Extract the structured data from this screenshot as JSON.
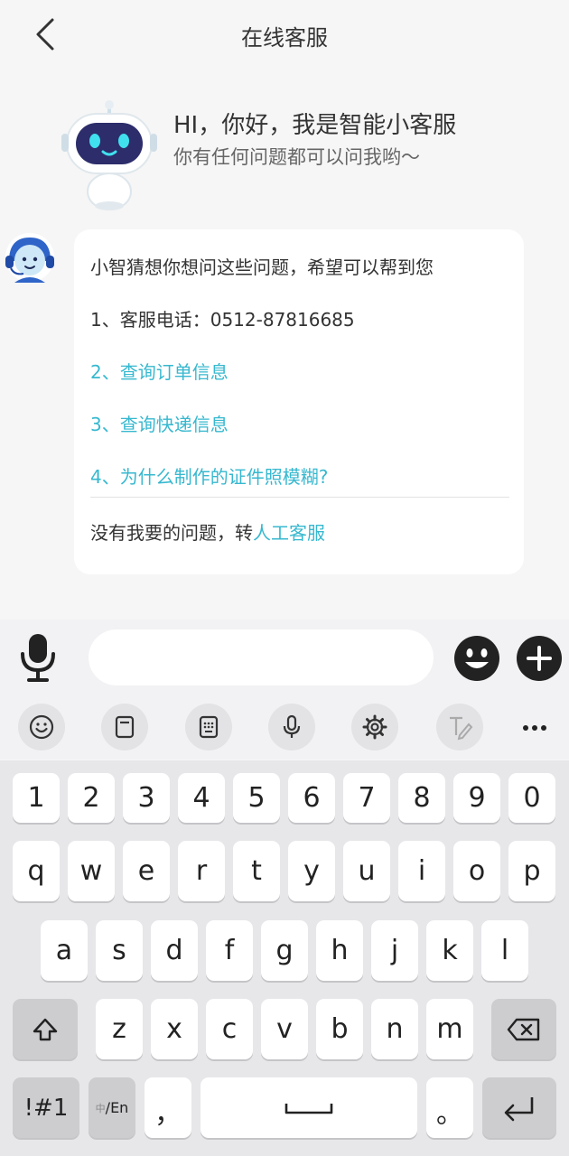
{
  "header": {
    "title": "在线客服"
  },
  "greeting": {
    "title": "HI，你好，我是智能小客服",
    "subtitle": "你有任何问题都可以问我哟～"
  },
  "message": {
    "intro": "小智猜想你想问这些问题，希望可以帮到您",
    "items": [
      {
        "text": "1、客服电话：0512-87816685",
        "link": false
      },
      {
        "text": "2、查询订单信息",
        "link": true
      },
      {
        "text": "3、查询快递信息",
        "link": true
      },
      {
        "text": "4、为什么制作的证件照模糊?",
        "link": true
      }
    ],
    "footer_prefix": "没有我要的问题，转",
    "footer_link": "人工客服"
  },
  "input": {
    "placeholder": ""
  },
  "toolbar": {
    "icons": [
      "emoji-icon",
      "clipboard-icon",
      "keyboard-layout-icon",
      "voice-icon",
      "settings-icon",
      "handwriting-icon",
      "more-icon"
    ]
  },
  "keyboard": {
    "number_row": [
      "1",
      "2",
      "3",
      "4",
      "5",
      "6",
      "7",
      "8",
      "9",
      "0"
    ],
    "row1": [
      "q",
      "w",
      "e",
      "r",
      "t",
      "y",
      "u",
      "i",
      "o",
      "p"
    ],
    "row2": [
      "a",
      "s",
      "d",
      "f",
      "g",
      "h",
      "j",
      "k",
      "l"
    ],
    "row3": [
      "z",
      "x",
      "c",
      "v",
      "b",
      "n",
      "m"
    ],
    "symbols_key": "!#1",
    "lang_key": {
      "prefix": "中",
      "suffix": "/En"
    },
    "comma_key": "，",
    "period_key": "。"
  },
  "colors": {
    "link": "#37b8cf",
    "background": "#f6f6f6",
    "keyboard_bg": "#e7e7ea"
  }
}
